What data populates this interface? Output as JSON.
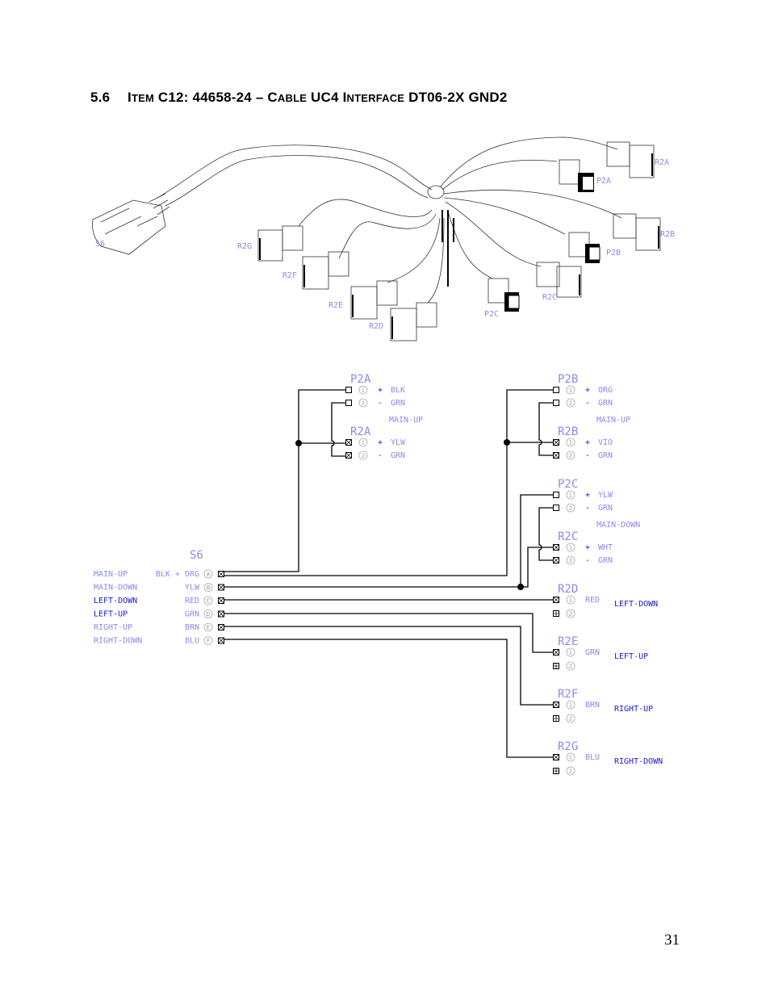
{
  "heading": {
    "number": "5.6",
    "title_parts": [
      "I",
      "TEM",
      " C12: 44658-24 – C",
      "ABLE",
      " UC4 I",
      "NTERFACE",
      " DT06-2X GND2"
    ]
  },
  "page_number": "31",
  "illustration": {
    "labels": {
      "s6": "S6",
      "r2g": "R2G",
      "r2f": "R2F",
      "r2e": "R2E",
      "r2d": "R2D",
      "r2a": "R2A",
      "p2a": "P2A",
      "r2b": "R2B",
      "p2b": "P2B",
      "r2c": "R2C",
      "p2c": "P2C"
    }
  },
  "schematic": {
    "s6": {
      "name": "S6",
      "rows": [
        {
          "function": "MAIN-UP",
          "color": "BLK + ORG",
          "pin": "A"
        },
        {
          "function": "MAIN-DOWN",
          "color": "YLW",
          "pin": "B"
        },
        {
          "function": "LEFT-DOWN",
          "color": "RED",
          "pin": "C"
        },
        {
          "function": "LEFT-UP",
          "color": "GRN",
          "pin": "D"
        },
        {
          "function": "RIGHT-UP",
          "color": "BRN",
          "pin": "E"
        },
        {
          "function": "RIGHT-DOWN",
          "color": "BLU",
          "pin": "F"
        }
      ]
    },
    "groups": [
      {
        "function": "MAIN-UP",
        "p": {
          "name": "P2A",
          "pins": [
            {
              "pin": "1",
              "sign": "+",
              "color": "BLK"
            },
            {
              "pin": "2",
              "sign": "-",
              "color": "GRN"
            }
          ]
        },
        "r": {
          "name": "R2A",
          "pins": [
            {
              "pin": "1",
              "sign": "+",
              "color": "YLW"
            },
            {
              "pin": "2",
              "sign": "-",
              "color": "GRN"
            }
          ]
        }
      },
      {
        "function": "MAIN-UP",
        "p": {
          "name": "P2B",
          "pins": [
            {
              "pin": "1",
              "sign": "+",
              "color": "ORG"
            },
            {
              "pin": "2",
              "sign": "-",
              "color": "GRN"
            }
          ]
        },
        "r": {
          "name": "R2B",
          "pins": [
            {
              "pin": "1",
              "sign": "+",
              "color": "VIO"
            },
            {
              "pin": "2",
              "sign": "-",
              "color": "GRN"
            }
          ]
        }
      },
      {
        "function": "MAIN-DOWN",
        "p": {
          "name": "P2C",
          "pins": [
            {
              "pin": "1",
              "sign": "+",
              "color": "YLW"
            },
            {
              "pin": "2",
              "sign": "-",
              "color": "GRN"
            }
          ]
        },
        "r": {
          "name": "R2C",
          "pins": [
            {
              "pin": "1",
              "sign": "+",
              "color": "WHT"
            },
            {
              "pin": "2",
              "sign": "-",
              "color": "GRN"
            }
          ]
        }
      }
    ],
    "singles": [
      {
        "name": "R2D",
        "pin": "1",
        "pin2": "2",
        "color": "RED",
        "function": "LEFT-DOWN"
      },
      {
        "name": "R2E",
        "pin": "1",
        "pin2": "2",
        "color": "GRN",
        "function": "LEFT-UP"
      },
      {
        "name": "R2F",
        "pin": "1",
        "pin2": "2",
        "color": "BRN",
        "function": "RIGHT-UP"
      },
      {
        "name": "R2G",
        "pin": "1",
        "pin2": "2",
        "color": "BLU",
        "function": "RIGHT-DOWN"
      }
    ]
  }
}
